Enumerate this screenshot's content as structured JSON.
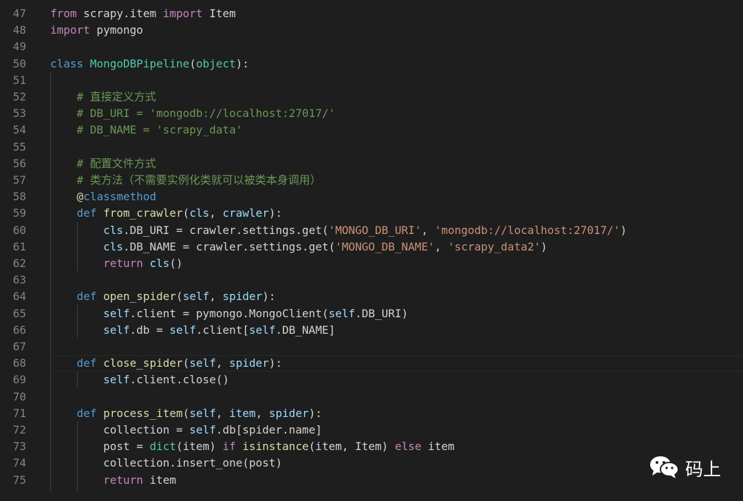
{
  "editor": {
    "lines": [
      {
        "n": "47",
        "tokens": [
          {
            "c": "kw",
            "t": "from"
          },
          {
            "t": " scrapy.item "
          },
          {
            "c": "kw",
            "t": "import"
          },
          {
            "t": " Item"
          }
        ]
      },
      {
        "n": "48",
        "tokens": [
          {
            "c": "kw",
            "t": "import"
          },
          {
            "t": " pymongo"
          }
        ]
      },
      {
        "n": "49",
        "tokens": []
      },
      {
        "n": "50",
        "tokens": [
          {
            "c": "st",
            "t": "class"
          },
          {
            "t": " "
          },
          {
            "c": "cls",
            "t": "MongoDBPipeline"
          },
          {
            "t": "("
          },
          {
            "c": "cls",
            "t": "object"
          },
          {
            "t": "):"
          }
        ]
      },
      {
        "n": "51",
        "tokens": []
      },
      {
        "n": "52",
        "tokens": [
          {
            "t": "    "
          },
          {
            "c": "cm",
            "t": "# 直接定义方式"
          }
        ]
      },
      {
        "n": "53",
        "tokens": [
          {
            "t": "    "
          },
          {
            "c": "cm",
            "t": "# DB_URI = 'mongodb://localhost:27017/'"
          }
        ]
      },
      {
        "n": "54",
        "tokens": [
          {
            "t": "    "
          },
          {
            "c": "cm",
            "t": "# DB_NAME = 'scrapy_data'"
          }
        ]
      },
      {
        "n": "55",
        "tokens": []
      },
      {
        "n": "56",
        "tokens": [
          {
            "t": "    "
          },
          {
            "c": "cm",
            "t": "# 配置文件方式"
          }
        ]
      },
      {
        "n": "57",
        "tokens": [
          {
            "t": "    "
          },
          {
            "c": "cm",
            "t": "# 类方法（不需要实例化类就可以被类本身调用）"
          }
        ]
      },
      {
        "n": "58",
        "tokens": [
          {
            "t": "    "
          },
          {
            "c": "fn",
            "t": "@"
          },
          {
            "c": "st",
            "t": "classmethod"
          }
        ]
      },
      {
        "n": "59",
        "tokens": [
          {
            "t": "    "
          },
          {
            "c": "st",
            "t": "def"
          },
          {
            "t": " "
          },
          {
            "c": "fn",
            "t": "from_crawler"
          },
          {
            "t": "("
          },
          {
            "c": "var",
            "t": "cls"
          },
          {
            "t": ", "
          },
          {
            "c": "var",
            "t": "crawler"
          },
          {
            "t": "):"
          }
        ]
      },
      {
        "n": "60",
        "tokens": [
          {
            "t": "        "
          },
          {
            "c": "var",
            "t": "cls"
          },
          {
            "t": ".DB_URI = crawler.settings.get("
          },
          {
            "c": "str",
            "t": "'MONGO_DB_URI'"
          },
          {
            "t": ", "
          },
          {
            "c": "str",
            "t": "'mongodb://localhost:27017/'"
          },
          {
            "t": ")"
          }
        ]
      },
      {
        "n": "61",
        "tokens": [
          {
            "t": "        "
          },
          {
            "c": "var",
            "t": "cls"
          },
          {
            "t": ".DB_NAME = crawler.settings.get("
          },
          {
            "c": "str",
            "t": "'MONGO_DB_NAME'"
          },
          {
            "t": ", "
          },
          {
            "c": "str",
            "t": "'scrapy_data2'"
          },
          {
            "t": ")"
          }
        ]
      },
      {
        "n": "62",
        "tokens": [
          {
            "t": "        "
          },
          {
            "c": "kw",
            "t": "return"
          },
          {
            "t": " "
          },
          {
            "c": "var",
            "t": "cls"
          },
          {
            "t": "()"
          }
        ]
      },
      {
        "n": "63",
        "tokens": []
      },
      {
        "n": "64",
        "tokens": [
          {
            "t": "    "
          },
          {
            "c": "st",
            "t": "def"
          },
          {
            "t": " "
          },
          {
            "c": "fn",
            "t": "open_spider"
          },
          {
            "t": "("
          },
          {
            "c": "var",
            "t": "self"
          },
          {
            "t": ", "
          },
          {
            "c": "var",
            "t": "spider"
          },
          {
            "t": "):"
          }
        ]
      },
      {
        "n": "65",
        "tokens": [
          {
            "t": "        "
          },
          {
            "c": "var",
            "t": "self"
          },
          {
            "t": ".client = pymongo.MongoClient("
          },
          {
            "c": "var",
            "t": "self"
          },
          {
            "t": ".DB_URI)"
          }
        ]
      },
      {
        "n": "66",
        "tokens": [
          {
            "t": "        "
          },
          {
            "c": "var",
            "t": "self"
          },
          {
            "t": ".db = "
          },
          {
            "c": "var",
            "t": "self"
          },
          {
            "t": ".client["
          },
          {
            "c": "var",
            "t": "self"
          },
          {
            "t": ".DB_NAME]"
          }
        ]
      },
      {
        "n": "67",
        "tokens": []
      },
      {
        "n": "68",
        "current": true,
        "tokens": [
          {
            "t": "    "
          },
          {
            "c": "st",
            "t": "def"
          },
          {
            "t": " "
          },
          {
            "c": "fn",
            "t": "close_spider"
          },
          {
            "t": "("
          },
          {
            "c": "var",
            "t": "self"
          },
          {
            "t": ", "
          },
          {
            "c": "var",
            "t": "spider"
          },
          {
            "t": "):"
          }
        ]
      },
      {
        "n": "69",
        "tokens": [
          {
            "t": "        "
          },
          {
            "c": "var",
            "t": "self"
          },
          {
            "t": ".client.close()"
          }
        ]
      },
      {
        "n": "70",
        "tokens": []
      },
      {
        "n": "71",
        "tokens": [
          {
            "t": "    "
          },
          {
            "c": "st",
            "t": "def"
          },
          {
            "t": " "
          },
          {
            "c": "fn",
            "t": "process_item"
          },
          {
            "t": "("
          },
          {
            "c": "var",
            "t": "self"
          },
          {
            "t": ", "
          },
          {
            "c": "var",
            "t": "item"
          },
          {
            "t": ", "
          },
          {
            "c": "var",
            "t": "spider"
          },
          {
            "t": "):"
          }
        ]
      },
      {
        "n": "72",
        "tokens": [
          {
            "t": "        collection = "
          },
          {
            "c": "var",
            "t": "self"
          },
          {
            "t": ".db[spider.name]"
          }
        ]
      },
      {
        "n": "73",
        "tokens": [
          {
            "t": "        post = "
          },
          {
            "c": "cls",
            "t": "dict"
          },
          {
            "t": "(item) "
          },
          {
            "c": "kw",
            "t": "if"
          },
          {
            "t": " "
          },
          {
            "c": "fn",
            "t": "isinstance"
          },
          {
            "t": "(item, Item) "
          },
          {
            "c": "kw",
            "t": "else"
          },
          {
            "t": " item"
          }
        ]
      },
      {
        "n": "74",
        "tokens": [
          {
            "t": "        collection.insert_one(post)"
          }
        ]
      },
      {
        "n": "75",
        "tokens": [
          {
            "t": "        "
          },
          {
            "c": "kw",
            "t": "return"
          },
          {
            "t": " item"
          }
        ]
      }
    ]
  },
  "watermark": {
    "text": "码上",
    "icon": "wechat-icon"
  },
  "colors": {
    "background": "#1e1e1e",
    "line_number": "#858585",
    "keyword_control": "#c586c0",
    "keyword_storage": "#569cd6",
    "class_name": "#4ec9b0",
    "function_name": "#dcdcaa",
    "parameter": "#9cdcfe",
    "string": "#ce9178",
    "comment": "#6a9955",
    "default_text": "#d4d4d4"
  }
}
